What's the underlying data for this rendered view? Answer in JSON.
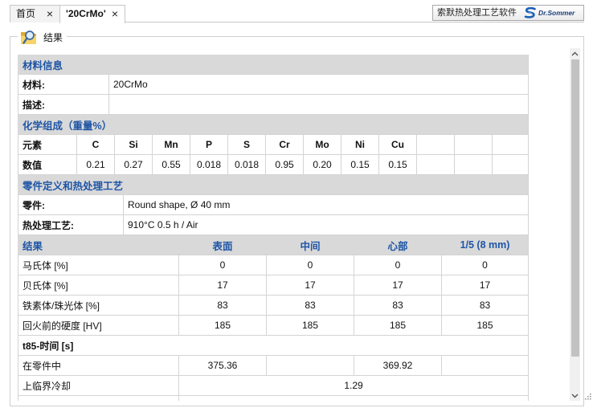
{
  "window": {
    "tabs": [
      {
        "label": "首页",
        "close": "×",
        "active": false
      },
      {
        "label": "'20CrMo'",
        "close": "×",
        "active": true
      }
    ],
    "brand": {
      "text": "索默热处理工艺软件",
      "logo": "Dr.Sommer"
    }
  },
  "results_panel": {
    "title": "结果",
    "icon": "folder-search-icon"
  },
  "material_info": {
    "header": "材料信息",
    "material_label": "材料:",
    "material_value": "20CrMo",
    "description_label": "描述:"
  },
  "chemistry": {
    "header": "化学组成（重量%）",
    "element_label": "元素",
    "value_label": "数值",
    "elements": [
      "C",
      "Si",
      "Mn",
      "P",
      "S",
      "Cr",
      "Mo",
      "Ni",
      "Cu"
    ],
    "values": [
      "0.21",
      "0.27",
      "0.55",
      "0.018",
      "0.018",
      "0.95",
      "0.20",
      "0.15",
      "0.15"
    ]
  },
  "part_definition": {
    "header": "零件定义和热处理工艺",
    "part_label": "零件:",
    "part_value": "Round shape, Ø 40 mm",
    "process_label": "热处理工艺:",
    "process_value": "910°C 0.5 h / Air"
  },
  "results": {
    "header": "结果",
    "columns": [
      "表面",
      "中间",
      "心部",
      "1/5 (8 mm)"
    ],
    "rows": [
      {
        "label": "马氏体 [%]",
        "values": [
          "0",
          "0",
          "0",
          "0"
        ]
      },
      {
        "label": "贝氏体 [%]",
        "values": [
          "17",
          "17",
          "17",
          "17"
        ]
      },
      {
        "label": "铁素体/珠光体 [%]",
        "values": [
          "83",
          "83",
          "83",
          "83"
        ]
      },
      {
        "label": "回火前的硬度 [HV]",
        "values": [
          "185",
          "185",
          "185",
          "185"
        ]
      }
    ]
  },
  "t85": {
    "header": "t85-时间 [s]",
    "in_part": {
      "label": "在零件中",
      "surface": "375.36",
      "core": "369.92"
    },
    "upper_critical": {
      "label": "上临界冷却",
      "value": "1.29"
    }
  },
  "scrollbar": {
    "scroll_position": 0,
    "visible_fraction": 0.9
  },
  "colors": {
    "section_header_text": "#1f55a6",
    "section_header_bg": "#d9d9d9",
    "grid_line": "#d4d4d4",
    "logo_blue": "#1a5fb4"
  }
}
